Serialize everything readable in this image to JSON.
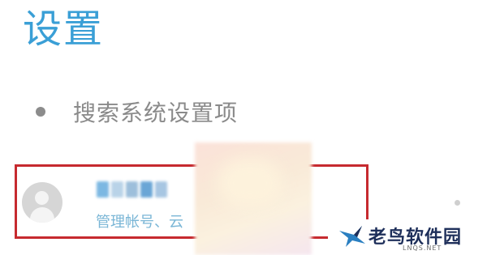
{
  "header": {
    "title": "设置"
  },
  "search": {
    "label": "搜索系统设置项"
  },
  "account": {
    "subtitle": "管理帐号、云",
    "avatar_icon": "person-icon",
    "name_blur_colors": [
      "#7cb8e2",
      "#b9d3e8",
      "#9dbfdb",
      "#6aa6d6",
      "#a7c6e2"
    ]
  },
  "watermark": {
    "name": "老鸟软件园",
    "domain": "LNQS.NET",
    "logo_icon": "bird-logo-icon"
  },
  "colors": {
    "title": "#3a9fd6",
    "highlight_border": "#c62a2f",
    "subtitle": "#7ab6d6"
  }
}
